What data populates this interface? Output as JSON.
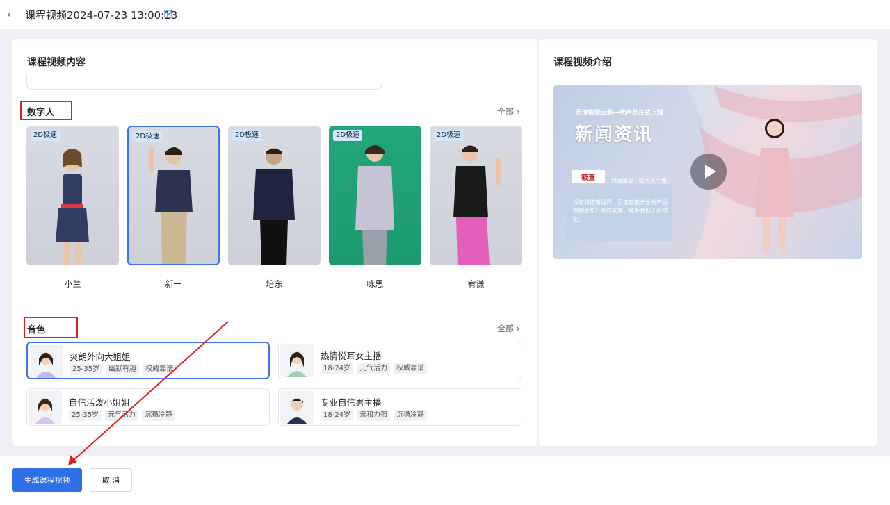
{
  "header": {
    "title": "课程视频2024-07-23 13:00:13"
  },
  "content": {
    "title": "课程视频内容",
    "digital_human": {
      "title": "数字人",
      "all_label": "全部 ›",
      "badge": "2D极速",
      "avatars": [
        {
          "name": "小兰"
        },
        {
          "name": "新一"
        },
        {
          "name": "培东"
        },
        {
          "name": "咏思"
        },
        {
          "name": "宥谦"
        }
      ]
    },
    "voice": {
      "title": "音色",
      "all_label": "全部 ›",
      "items": [
        {
          "name": "爽朗外向大姐姐",
          "tags": [
            "25-35岁",
            "幽默有趣",
            "权威靠谱"
          ]
        },
        {
          "name": "热情悦耳女主播",
          "tags": [
            "18-24岁",
            "元气活力",
            "权威靠谱"
          ]
        },
        {
          "name": "自信活泼小姐姐",
          "tags": [
            "25-35岁",
            "元气活力",
            "沉稳冷静"
          ]
        },
        {
          "name": "专业自信男主播",
          "tags": [
            "18-24岁",
            "亲和力强",
            "沉稳冷静"
          ]
        }
      ]
    }
  },
  "intro": {
    "title": "课程视频介绍",
    "video": {
      "subtitle": "百度智能云新一代产品正式上线",
      "headline": "新闻资讯",
      "anchor_name": "筱萱",
      "anchor_role": "百度曦灵 · 数字人主播",
      "caption": "探索科技新境界：百度智能云全新产品震撼发布！面向未来，携手共创无限可能。"
    }
  },
  "footer": {
    "generate_label": "生成课程视频",
    "cancel_label": "取 消"
  },
  "colors": {
    "primary": "#2f6fe6",
    "highlight": "#e02020",
    "selected_border": "#3d74ea"
  }
}
